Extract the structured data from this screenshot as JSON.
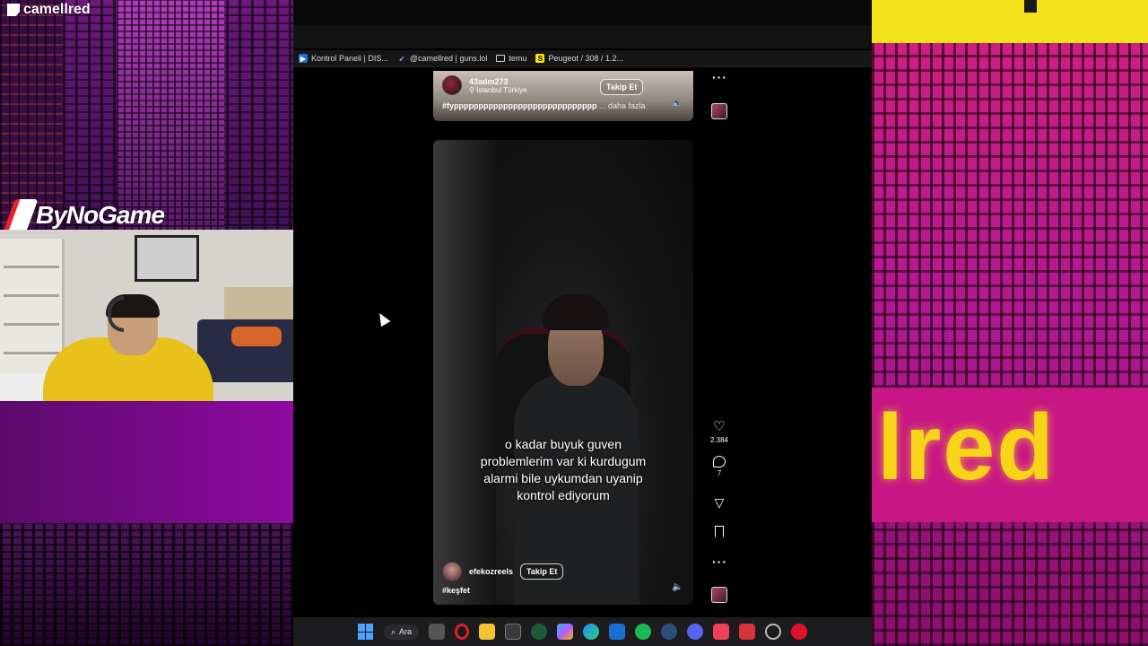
{
  "stream": {
    "channel_name": "camellred",
    "sponsor_logo_text": "ByNoGame",
    "brand_sign_text": "lred"
  },
  "browser": {
    "bookmarks": [
      {
        "label": "Kontrol Paneli | DIS...",
        "icon": "dashboard-icon",
        "color": "#2f8fff"
      },
      {
        "label": "@camellred | guns.lol",
        "icon": "guns-lol-icon",
        "color": "#b07cff"
      },
      {
        "label": "temu",
        "icon": "folder-icon",
        "color": "#d8d8d8"
      },
      {
        "label": "Peugeot / 308 / 1.2...",
        "icon": "sahibinden-icon",
        "color": "#ffe600"
      }
    ]
  },
  "feed": {
    "reel_top": {
      "username": "43adm273",
      "location": "İstanbul Türkiye",
      "follow_label": "Takip Et",
      "caption": "#fyppppppppppppppppppppppppppppp",
      "more_label": "... daha fazla"
    },
    "reel_main": {
      "subtitle": "o kadar buyuk guven problemlerim var ki kurdugum alarmi bile uykumdan uyanip kontrol ediyorum",
      "username": "efekozreels",
      "follow_label": "Takip Et",
      "caption": "#keşfet",
      "like_count": "2.384",
      "comment_count": "7"
    }
  },
  "taskbar": {
    "search_label": "Ara",
    "apps": [
      "file-icon",
      "opera-icon",
      "explorer-icon",
      "store-icon",
      "xbox-icon",
      "copilot-icon",
      "edge-icon",
      "mail-icon",
      "spotify-icon",
      "steam-icon",
      "discord-icon",
      "pocket-icon",
      "vivaldi-icon",
      "settings-icon",
      "record-icon"
    ]
  },
  "colors": {
    "accent_pink": "#c81784",
    "sign_yellow": "#f7d418",
    "panel_purple": "#8e0aa0"
  }
}
